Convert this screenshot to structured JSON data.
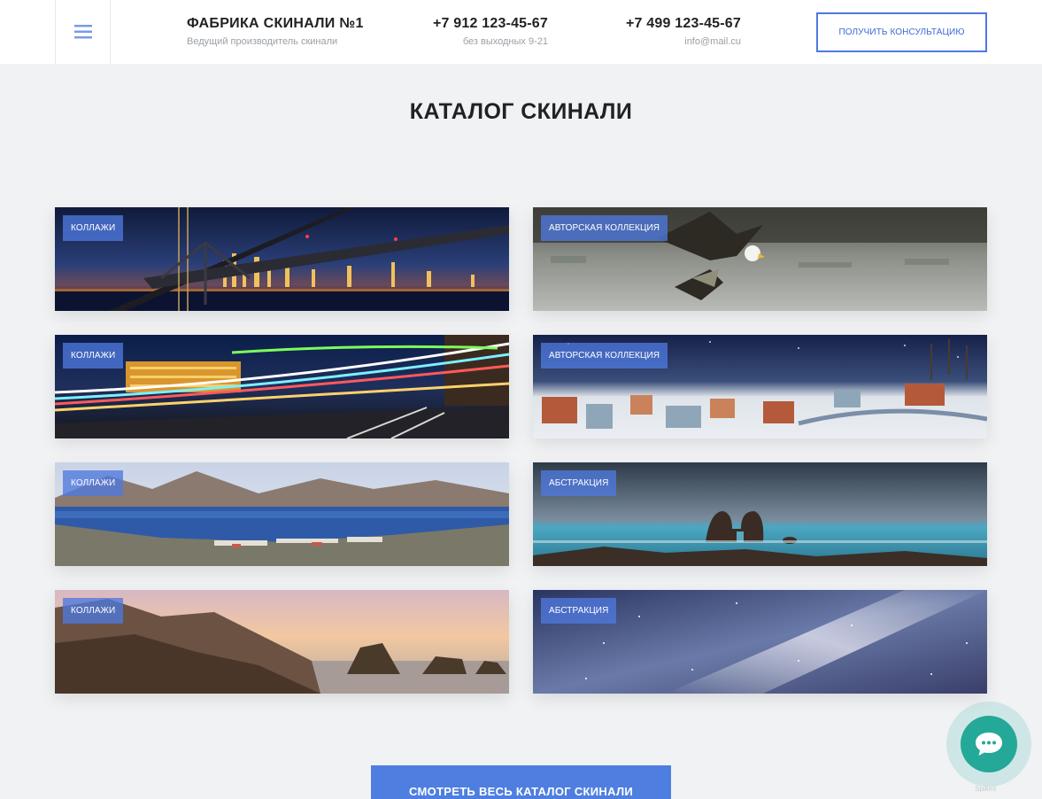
{
  "header": {
    "menu_icon": "hamburger-icon",
    "brand_title": "ФАБРИКА СКИНАЛИ №1",
    "brand_subtitle": "Ведущий производитель скинали",
    "phone1": "+7 912 123-45-67",
    "phone1_note": "без выходных 9-21",
    "phone2": "+7 499 123-45-67",
    "phone2_note": "info@mail.cu",
    "consult_label": "ПОЛУЧИТЬ КОНСУЛЬТАЦИЮ"
  },
  "catalog": {
    "title": "КАТАЛОГ СКИНАЛИ",
    "cards": [
      {
        "badge": "КОЛЛАЖИ",
        "image": "night-bridge-city"
      },
      {
        "badge": "АВТОРСКАЯ КОЛЛЕКЦИЯ",
        "image": "eagle-over-water"
      },
      {
        "badge": "КОЛЛАЖИ",
        "image": "city-light-trails"
      },
      {
        "badge": "АВТОРСКАЯ КОЛЛЕКЦИЯ",
        "image": "painted-winter-village"
      },
      {
        "badge": "КОЛЛАЖИ",
        "image": "mountain-lake-panorama"
      },
      {
        "badge": "АБСТРАКЦИЯ",
        "image": "sea-rock-arch"
      },
      {
        "badge": "КОЛЛАЖИ",
        "image": "sunset-coastal-cliffs"
      },
      {
        "badge": "АБСТРАКЦИЯ",
        "image": "milky-way-sky"
      }
    ],
    "cta_label": "СМОТРЕТЬ ВЕСЬ КАТАЛОГ СКИНАЛИ"
  },
  "chat_widget": {
    "icon": "chat-bubble-icon",
    "brand": "Spikmi",
    "color": "#24a897"
  },
  "colors": {
    "accent": "#4e79de",
    "background": "#f1f2f4"
  }
}
